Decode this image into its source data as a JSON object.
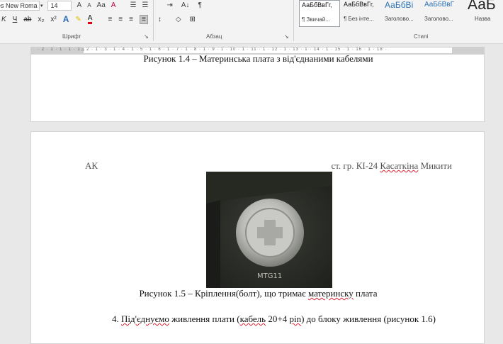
{
  "ribbon": {
    "font_name": "es New Roma",
    "font_size": "14",
    "row1_buttons": [
      "A",
      "A",
      "Aa",
      "A"
    ],
    "para_row1": [
      "☰",
      "☰",
      "⇥",
      "A↓",
      "¶"
    ],
    "row2_left": [
      "K",
      "Ч",
      "ab",
      "x₂",
      "x²"
    ],
    "highlight_glyph": "✎",
    "fontcolor_glyph": "A",
    "align_glyphs": [
      "≡",
      "≡",
      "≡",
      "≡"
    ],
    "group_font": "Шрифт",
    "group_paragraph": "Абзац",
    "group_styles": "Стилі",
    "styles": [
      {
        "sample": "АаБбВвГг,",
        "name": "¶ Звичай..."
      },
      {
        "sample": "АаБбВвГг,",
        "name": "¶ Без інте..."
      },
      {
        "sample": "АаБбВі",
        "name": "Заголово..."
      },
      {
        "sample": "АаБбВвГ",
        "name": "Заголово..."
      },
      {
        "sample": "АаБ",
        "name": "Назва"
      }
    ]
  },
  "ruler": {
    "text": "· 2 · 1 · 1 · 1 · 1 · 2 · 1 · 3 · 1 · 4 · 1 · 5 · 1 · 6 · 1 · 7 · 1 · 8 · 1 · 9 · 1 · 10 · 1 · 11 · 1 · 12 · 1 · 13 · 1 · 14 · 1 · 15 · 1 · 16 · 1 · 18 ·"
  },
  "doc": {
    "caption_1_4": "Рисунок 1.4 – Материнська плата з від'єднаними кабелями",
    "header_left": "АК",
    "header_right_prefix": "ст. гр. КІ-24 ",
    "header_right_name": "Касаткіна",
    "header_right_suffix": " Микити",
    "photo_marking": "MTG11",
    "caption_1_5_prefix": "Рисунок 1.5 – Кріплення(болт), що тримає ",
    "caption_1_5_word": "материнску",
    "caption_1_5_suffix": " плата",
    "para_num": "4. ",
    "para_w1": "Під'єднуємо",
    "para_t1": " живлення  плати (",
    "para_w2": "кабель",
    "para_t2": " 20+4 ",
    "para_w3": "pin",
    "para_t3": ") до блоку живлення (рисунок 1.6)"
  }
}
